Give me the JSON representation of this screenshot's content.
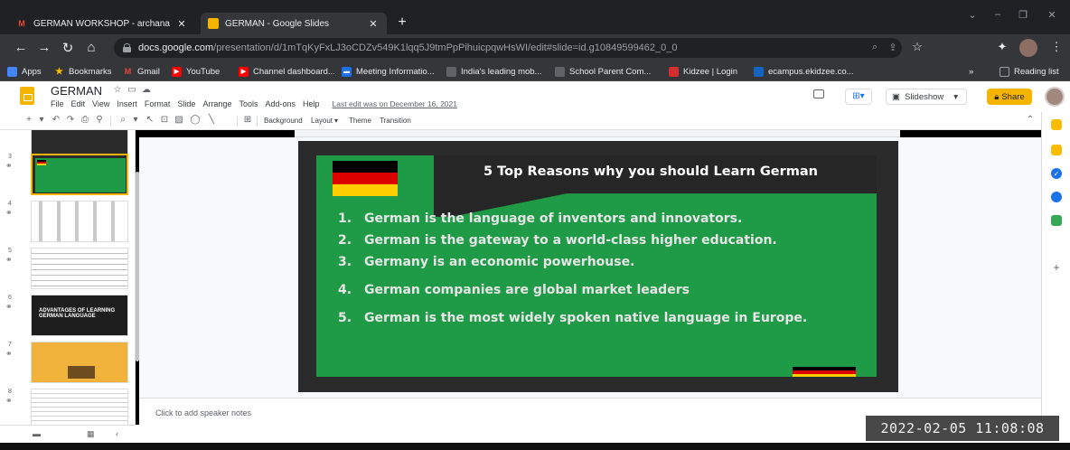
{
  "browser": {
    "tabs": [
      {
        "title": "GERMAN WORKSHOP - archana",
        "icon": "gmail-icon",
        "active": false
      },
      {
        "title": "GERMAN - Google Slides",
        "icon": "slides-icon",
        "active": true
      }
    ],
    "url_domain": "docs.google.com",
    "url_path": "/presentation/d/1mTqKyFxLJ3oCDZv549K1lqq5J9tmPpPihuicpqwHsWI/edit#slide=id.g10849599462_0_0",
    "bookmarks": [
      {
        "label": "Apps",
        "color": "#4285f4"
      },
      {
        "label": "Bookmarks",
        "color": "#fbbc04"
      },
      {
        "label": "Gmail",
        "color": "#ea4335"
      },
      {
        "label": "YouTube",
        "color": "#ff0000"
      },
      {
        "label": "Channel dashboard...",
        "color": "#ff0000"
      },
      {
        "label": "Meeting Informatio...",
        "color": "#1a73e8"
      },
      {
        "label": "India's leading mob...",
        "color": "#5f6368"
      },
      {
        "label": "School Parent Com...",
        "color": "#5f6368"
      },
      {
        "label": "Kidzee | Login",
        "color": "#d32f2f"
      },
      {
        "label": "ecampus.ekidzee.co...",
        "color": "#1565c0"
      },
      {
        "label": "»",
        "color": ""
      },
      {
        "label": "Reading list",
        "color": "#9aa0a6"
      }
    ]
  },
  "app": {
    "doc_title": "GERMAN",
    "menu": [
      "File",
      "Edit",
      "View",
      "Insert",
      "Format",
      "Slide",
      "Arrange",
      "Tools",
      "Add-ons",
      "Help"
    ],
    "last_edit": "Last edit was on December 16, 2021",
    "slideshow_label": "Slideshow",
    "share_label": "Share",
    "accent": "#f4b400"
  },
  "toolbar": {
    "background_label": "Background",
    "layout_label": "Layout",
    "theme_label": "Theme",
    "transition_label": "Transition"
  },
  "filmstrip": {
    "slide_numbers": [
      "3",
      "4",
      "5",
      "6",
      "7",
      "8"
    ],
    "thumb6_text": "ADVANTAGES OF LEARNING GERMAN LANGUAGE"
  },
  "slide": {
    "title": "5 Top Reasons why you should Learn German",
    "reasons": [
      {
        "num": "1.",
        "text": "German is the language of inventors and innovators."
      },
      {
        "num": "2.",
        "text": "German is the gateway to a world-class higher education."
      },
      {
        "num": "3.",
        "text": "Germany is an economic powerhouse."
      },
      {
        "num": "4.",
        "text": "German companies are global market leaders"
      },
      {
        "num": "5.",
        "text": "German is the most widely spoken native language in Europe."
      }
    ],
    "green": "#1f9a46",
    "flag_colors": [
      "#000000",
      "#dd0000",
      "#ffce00"
    ]
  },
  "notes": {
    "placeholder": "Click to add speaker notes"
  },
  "overlay": {
    "timestamp": "2022-02-05 11:08:08"
  }
}
